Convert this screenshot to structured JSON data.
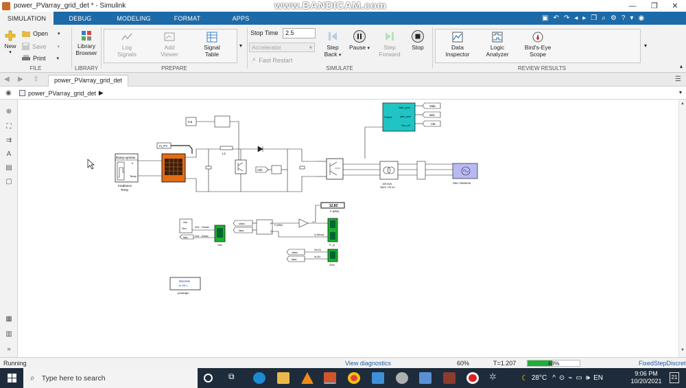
{
  "window": {
    "title": "power_PVarray_grid_det * - Simulink",
    "watermark": "www.BANDICAM.com",
    "minimize": "—",
    "maximize": "❐",
    "close": "✕"
  },
  "tabs": [
    {
      "label": "SIMULATION"
    },
    {
      "label": "DEBUG"
    },
    {
      "label": "MODELING"
    },
    {
      "label": "FORMAT"
    },
    {
      "label": "APPS"
    }
  ],
  "ribbon": {
    "file": {
      "label": "FILE",
      "new": "New",
      "open": "Open",
      "save": "Save",
      "print": "Print"
    },
    "library": {
      "label": "LIBRARY",
      "browser": "Library Browser"
    },
    "prepare": {
      "label": "PREPARE",
      "log_signals": "Log Signals",
      "add_viewer": "Add Viewer",
      "signal_table": "Signal Table"
    },
    "simulate": {
      "label": "SIMULATE",
      "stop_time_label": "Stop Time",
      "stop_time_value": "2.5",
      "accelerator": "Accelerator",
      "fast_restart": "Fast Restart",
      "step_back": "Step Back",
      "pause": "Pause",
      "step_forward": "Step Forward",
      "stop": "Stop"
    },
    "review": {
      "label": "REVIEW RESULTS",
      "data_inspector": "Data Inspector",
      "logic_analyzer": "Logic Analyzer",
      "birds_eye": "Bird's-Eye Scope"
    }
  },
  "doc_tab": "power_PVarray_grid_det",
  "breadcrumb": "power_PVarray_grid_det",
  "model": {
    "irr_block_label": "Ramp-upView",
    "irr_ports": [
      "Ir",
      "Temp"
    ],
    "irr_caption": "Irradiance",
    "temp_caption": "Temp",
    "m_pv_tag": "m_PV",
    "const_value": "0.5",
    "l1_label": "L1",
    "vdc_tag": "Vdc",
    "control_out": [
      "Vabc_prim",
      "Iabc_prim",
      "Vdc_ctrl"
    ],
    "control_tags": [
      "Vabc",
      "Iabc",
      "Vdc"
    ],
    "control_in": "Pulses",
    "transformer_label": "100 kVA",
    "transformer_sub": "260V / 25 kV",
    "grid_label": "25kV 2500MVA",
    "display_value": "12.82",
    "display_label": "P (MW)",
    "meas1_ports": [
      "Vdc",
      "Vinv",
      "Iabc"
    ],
    "meas1_out": [
      "Vmf - Vmean",
      "Vmf - Imean"
    ],
    "vdc_scope_label": "Vdc",
    "p_tags": [
      "Vabc",
      "Iabc"
    ],
    "p_block_ports": [
      "P",
      "Q"
    ],
    "p_mw_label": "P (MW)",
    "q_mvar_label": "Q (Mvar)",
    "p_q_scope_label": "P_Q",
    "grid_tags": [
      "Vabc",
      "Iabc"
    ],
    "grid_sigs": [
      "Va (V)",
      "Ia (A)"
    ],
    "grid_scope_label": "Grid",
    "powergui_top": "Discrete",
    "powergui_mid": "1e-06 s.",
    "powergui_caption": "powergui"
  },
  "status": {
    "state": "Running",
    "diagnostics": "View diagnostics",
    "zoom": "60%",
    "time": "T=1.207",
    "progress_pct": "48%",
    "progress_fraction": 0.48,
    "solver": "FixedStepDiscrete"
  },
  "taskbar": {
    "search_placeholder": "Type here to search",
    "weather": "28°C",
    "time": "9:06 PM",
    "date": "10/20/2021"
  }
}
